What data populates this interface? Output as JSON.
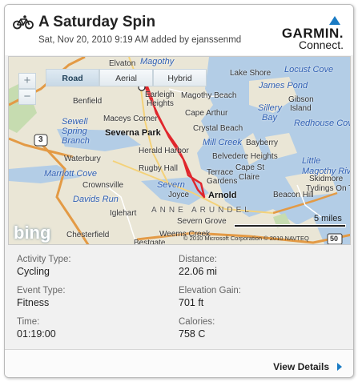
{
  "header": {
    "icon": "bicycle-icon",
    "title": "A Saturday Spin",
    "subtitle": "Sat, Nov 20, 2010 9:19 AM added by ejanssenmd",
    "brand": {
      "name": "GARMIN.",
      "product": "Connect.",
      "accent": "#1a7bc4"
    }
  },
  "map": {
    "types": [
      {
        "label": "Road",
        "active": true
      },
      {
        "label": "Aerial",
        "active": false
      },
      {
        "label": "Hybrid",
        "active": false
      }
    ],
    "zoom_in": "+",
    "zoom_out": "−",
    "provider": "bing",
    "scale": "5 miles",
    "copyright": "© 2010 Microsoft Corporation   © 2010 NAVTEQ",
    "labels": {
      "elvaton": "Elvaton",
      "magothy": "Magothy",
      "benfield": "Benfield",
      "earleigh": "Earleigh",
      "heights": "Heights",
      "magothy_beach": "Magothy Beach",
      "lake_shore": "Lake Shore",
      "locust_cove": "Locust Cove",
      "james_pond": "James Pond",
      "gibson": "Gibson",
      "island": "Island",
      "sillery": "Sillery",
      "bay": "Bay",
      "redhouse_cove": "Redhouse Cove",
      "cape_arthur": "Cape Arthur",
      "maceys_corner": "Maceys Corner",
      "sewell": "Sewell",
      "spring": "Spring",
      "branch": "Branch",
      "severna_park": "Severna Park",
      "crystal_beach": "Crystal Beach",
      "mill_creek": "Mill Creek",
      "bayberry": "Bayberry",
      "herald_harbor": "Herald Harbor",
      "belvedere_heights": "Belvedere Heights",
      "waterbury": "Waterbury",
      "marriott_cove": "Marriott Cove",
      "rugby_hall": "Rugby Hall",
      "cape_st": "Cape St",
      "claire": "Claire",
      "little": "Little",
      "magothy_river": "Magothy River",
      "terrace": "Terrace",
      "gardens": "Gardens",
      "davids_run": "Davids Run",
      "crownsville": "Crownsville",
      "severn": "Severn",
      "joyce": "Joyce",
      "arnold": "Arnold",
      "beacon_hill": "Beacon Hill",
      "tydings": "Tydings On T",
      "skidmore": "Skidmore",
      "iglehart": "Iglehart",
      "anne_arundel": "ANNE ARUNDEL",
      "severn_grove": "Severn Grove",
      "chesterfield": "Chesterfield",
      "weems_creek": "Weems Creek",
      "bestgate": "Bestgate",
      "route_3": "3",
      "route_50": "50"
    }
  },
  "stats": [
    {
      "label": "Activity Type:",
      "value": "Cycling"
    },
    {
      "label": "Distance:",
      "value": "22.06 mi"
    },
    {
      "label": "Event Type:",
      "value": "Fitness"
    },
    {
      "label": "Elevation Gain:",
      "value": "701 ft"
    },
    {
      "label": "Time:",
      "value": "01:19:00"
    },
    {
      "label": "Calories:",
      "value": "758 C"
    }
  ],
  "footer": {
    "view_details": "View Details"
  }
}
